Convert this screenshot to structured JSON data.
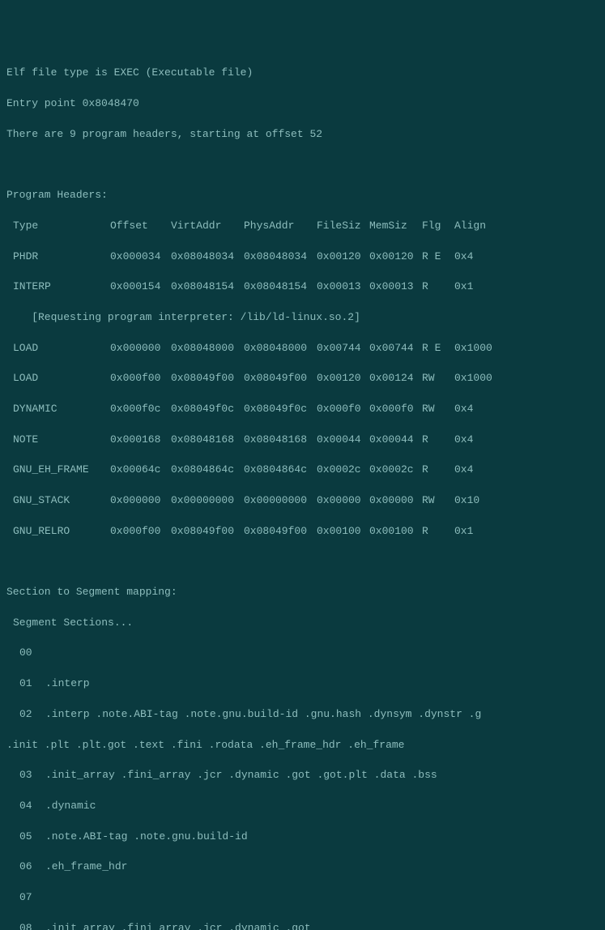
{
  "header": {
    "file_type_line": "Elf file type is EXEC (Executable file)",
    "entry_point_line": "Entry point 0x8048470",
    "program_headers_count_line": "There are 9 program headers, starting at offset 52"
  },
  "program_headers_title": "Program Headers:",
  "columns": {
    "type": "Type",
    "offset": "Offset",
    "virtaddr": "VirtAddr",
    "physaddr": "PhysAddr",
    "filesiz": "FileSiz",
    "memsiz": "MemSiz",
    "flg": "Flg",
    "align": "Align"
  },
  "headers": [
    {
      "type": "PHDR",
      "offset": "0x000034",
      "virt": "0x08048034",
      "phys": "0x08048034",
      "filesz": "0x00120",
      "memsz": "0x00120",
      "flg": "R E",
      "align": "0x4"
    },
    {
      "type": "INTERP",
      "offset": "0x000154",
      "virt": "0x08048154",
      "phys": "0x08048154",
      "filesz": "0x00013",
      "memsz": "0x00013",
      "flg": "R",
      "align": "0x1"
    },
    {
      "type": "LOAD",
      "offset": "0x000000",
      "virt": "0x08048000",
      "phys": "0x08048000",
      "filesz": "0x00744",
      "memsz": "0x00744",
      "flg": "R E",
      "align": "0x1000"
    },
    {
      "type": "LOAD",
      "offset": "0x000f00",
      "virt": "0x08049f00",
      "phys": "0x08049f00",
      "filesz": "0x00120",
      "memsz": "0x00124",
      "flg": "RW",
      "align": "0x1000"
    },
    {
      "type": "DYNAMIC",
      "offset": "0x000f0c",
      "virt": "0x08049f0c",
      "phys": "0x08049f0c",
      "filesz": "0x000f0",
      "memsz": "0x000f0",
      "flg": "RW",
      "align": "0x4"
    },
    {
      "type": "NOTE",
      "offset": "0x000168",
      "virt": "0x08048168",
      "phys": "0x08048168",
      "filesz": "0x00044",
      "memsz": "0x00044",
      "flg": "R",
      "align": "0x4"
    },
    {
      "type": "GNU_EH_FRAME",
      "offset": "0x00064c",
      "virt": "0x0804864c",
      "phys": "0x0804864c",
      "filesz": "0x0002c",
      "memsz": "0x0002c",
      "flg": "R",
      "align": "0x4"
    },
    {
      "type": "GNU_STACK",
      "offset": "0x000000",
      "virt": "0x00000000",
      "phys": "0x00000000",
      "filesz": "0x00000",
      "memsz": "0x00000",
      "flg": "RW",
      "align": "0x10"
    },
    {
      "type": "GNU_RELRO",
      "offset": "0x000f00",
      "virt": "0x08049f00",
      "phys": "0x08049f00",
      "filesz": "0x00100",
      "memsz": "0x00100",
      "flg": "R",
      "align": "0x1"
    }
  ],
  "interpreter_line": "    [Requesting program interpreter: /lib/ld-linux.so.2]",
  "section_mapping_title": "Section to Segment mapping:",
  "segment_sections_label": "Segment Sections...",
  "segments": [
    {
      "num": "00",
      "sections": ""
    },
    {
      "num": "01",
      "sections": ".interp"
    },
    {
      "num": "02",
      "sections": ".interp .note.ABI-tag .note.gnu.build-id .gnu.hash .dynsym .dynstr .g"
    },
    {
      "num": "03",
      "sections": ".init_array .fini_array .jcr .dynamic .got .got.plt .data .bss"
    },
    {
      "num": "04",
      "sections": ".dynamic"
    },
    {
      "num": "05",
      "sections": ".note.ABI-tag .note.gnu.build-id"
    },
    {
      "num": "06",
      "sections": ".eh_frame_hdr"
    },
    {
      "num": "07",
      "sections": ""
    },
    {
      "num": "08",
      "sections": ".init_array .fini_array .jcr .dynamic .got"
    }
  ],
  "wrap_line": ".init .plt .plt.got .text .fini .rodata .eh_frame_hdr .eh_frame"
}
